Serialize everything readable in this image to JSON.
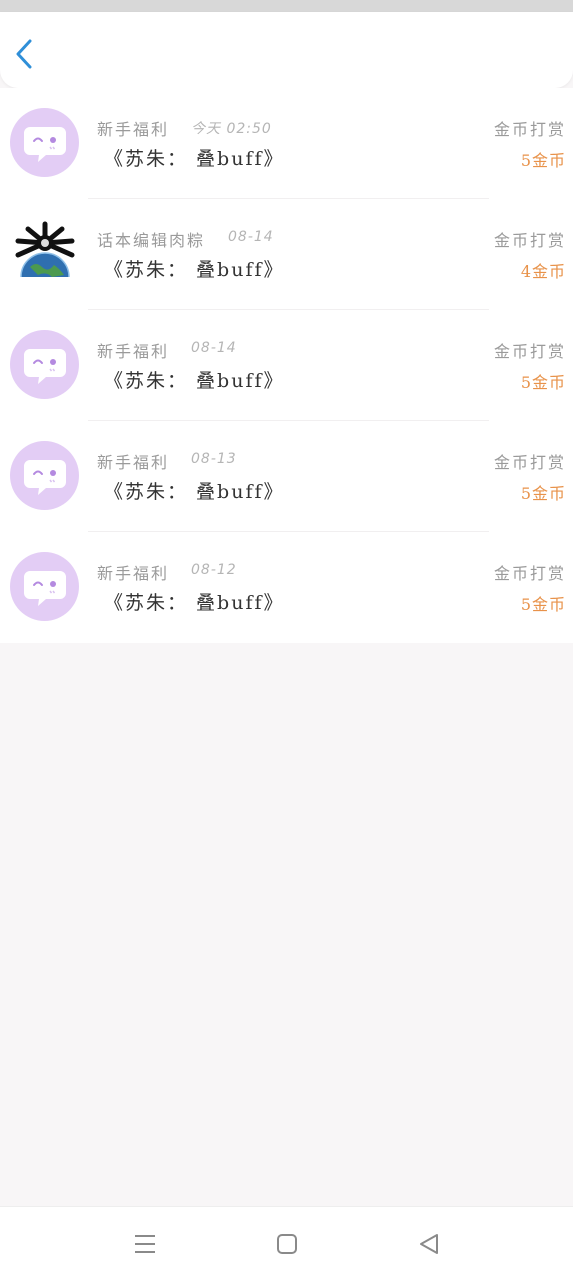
{
  "colors": {
    "accent": "#2f8fd8",
    "coin": "#e8924a",
    "avatar_bg": "#e3cdf5",
    "avatar_fg": "#b48ae0"
  },
  "header": {
    "back_icon": "chevron-left-icon"
  },
  "rewards": [
    {
      "name": "新手福利",
      "time": "今天 02:50",
      "title": "《苏朱： 叠buff》",
      "type": "金币打赏",
      "coins": "5金币",
      "avatar": "chat-bubble-avatar"
    },
    {
      "name": "话本编辑肉粽",
      "time": "08-14",
      "title": "《苏朱： 叠buff》",
      "type": "金币打赏",
      "coins": "4金币",
      "avatar": "globe-avatar"
    },
    {
      "name": "新手福利",
      "time": "08-14",
      "title": "《苏朱： 叠buff》",
      "type": "金币打赏",
      "coins": "5金币",
      "avatar": "chat-bubble-avatar"
    },
    {
      "name": "新手福利",
      "time": "08-13",
      "title": "《苏朱： 叠buff》",
      "type": "金币打赏",
      "coins": "5金币",
      "avatar": "chat-bubble-avatar"
    },
    {
      "name": "新手福利",
      "time": "08-12",
      "title": "《苏朱： 叠buff》",
      "type": "金币打赏",
      "coins": "5金币",
      "avatar": "chat-bubble-avatar"
    }
  ],
  "navbar": {
    "icons": [
      "menu-icon",
      "home-square-icon",
      "back-triangle-icon"
    ]
  }
}
